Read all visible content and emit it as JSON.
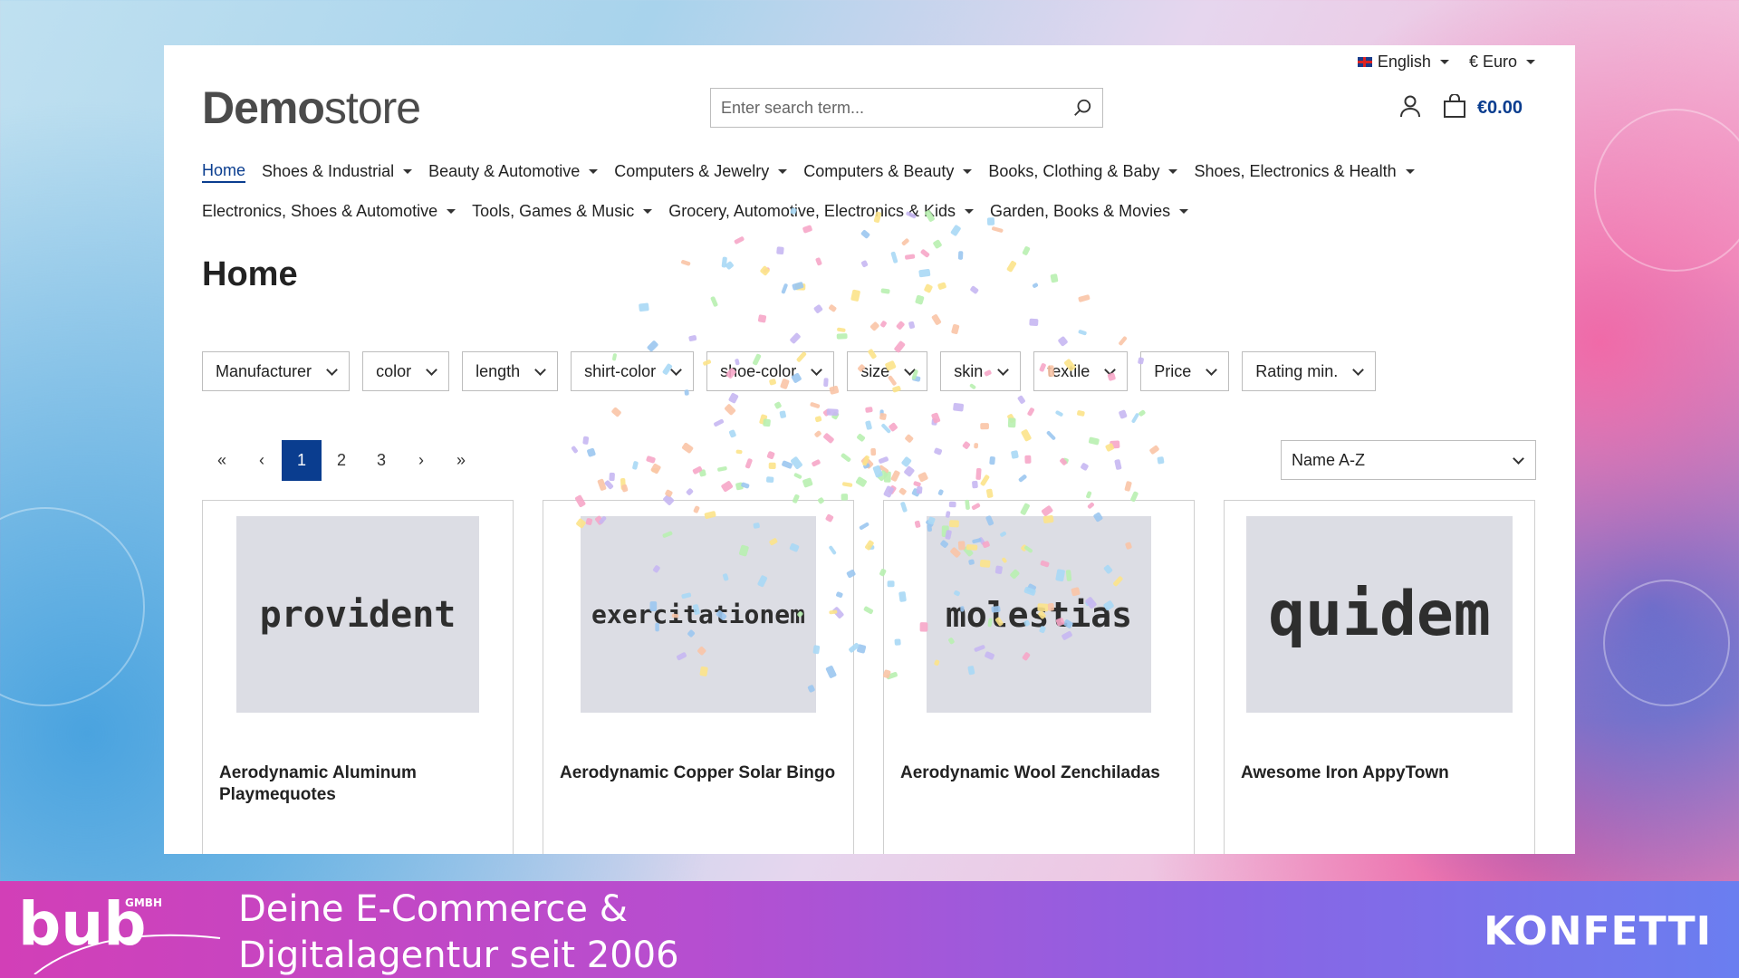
{
  "topbar": {
    "language": "English",
    "currency": "€ Euro"
  },
  "header": {
    "logo_bold": "Demo",
    "logo_light": "store",
    "search_placeholder": "Enter search term...",
    "cart_total": "€0.00"
  },
  "nav": {
    "items": [
      {
        "label": "Home",
        "active": true,
        "dropdown": false
      },
      {
        "label": "Shoes & Industrial",
        "dropdown": true
      },
      {
        "label": "Beauty & Automotive",
        "dropdown": true
      },
      {
        "label": "Computers & Jewelry",
        "dropdown": true
      },
      {
        "label": "Computers & Beauty",
        "dropdown": true
      },
      {
        "label": "Books, Clothing & Baby",
        "dropdown": true
      },
      {
        "label": "Shoes, Electronics & Health",
        "dropdown": true
      },
      {
        "label": "Electronics, Shoes & Automotive",
        "dropdown": true
      },
      {
        "label": "Tools, Games & Music",
        "dropdown": true
      },
      {
        "label": "Grocery, Automotive, Electronics & Kids",
        "dropdown": true
      },
      {
        "label": "Garden, Books & Movies",
        "dropdown": true
      }
    ]
  },
  "page": {
    "title": "Home"
  },
  "filters": [
    "Manufacturer",
    "color",
    "length",
    "shirt-color",
    "shoe-color",
    "size",
    "skin",
    "textile",
    "Price",
    "Rating min."
  ],
  "pagination": {
    "first": "«",
    "prev": "‹",
    "pages": [
      "1",
      "2",
      "3"
    ],
    "current": "1",
    "next": "›",
    "last": "»"
  },
  "sort": {
    "selected": "Name A-Z"
  },
  "products": [
    {
      "image_text": "provident",
      "title": "Aerodynamic Aluminum Playmequotes"
    },
    {
      "image_text": "exercitationem",
      "title": "Aerodynamic Copper Solar Bingo"
    },
    {
      "image_text": "molestias",
      "title": "Aerodynamic Wool Zenchiladas"
    },
    {
      "image_text": "quidem",
      "title": "Awesome Iron AppyTown"
    }
  ],
  "banner": {
    "logo": "bub",
    "logo_sub": "GMBH",
    "line1": "Deine E-Commerce &",
    "line2": "Digitalagentur seit 2006",
    "tag": "KONFETTI"
  },
  "colors": {
    "accent": "#0a3d8f",
    "banner_start": "#d23fb7",
    "banner_end": "#6a7ef0"
  }
}
